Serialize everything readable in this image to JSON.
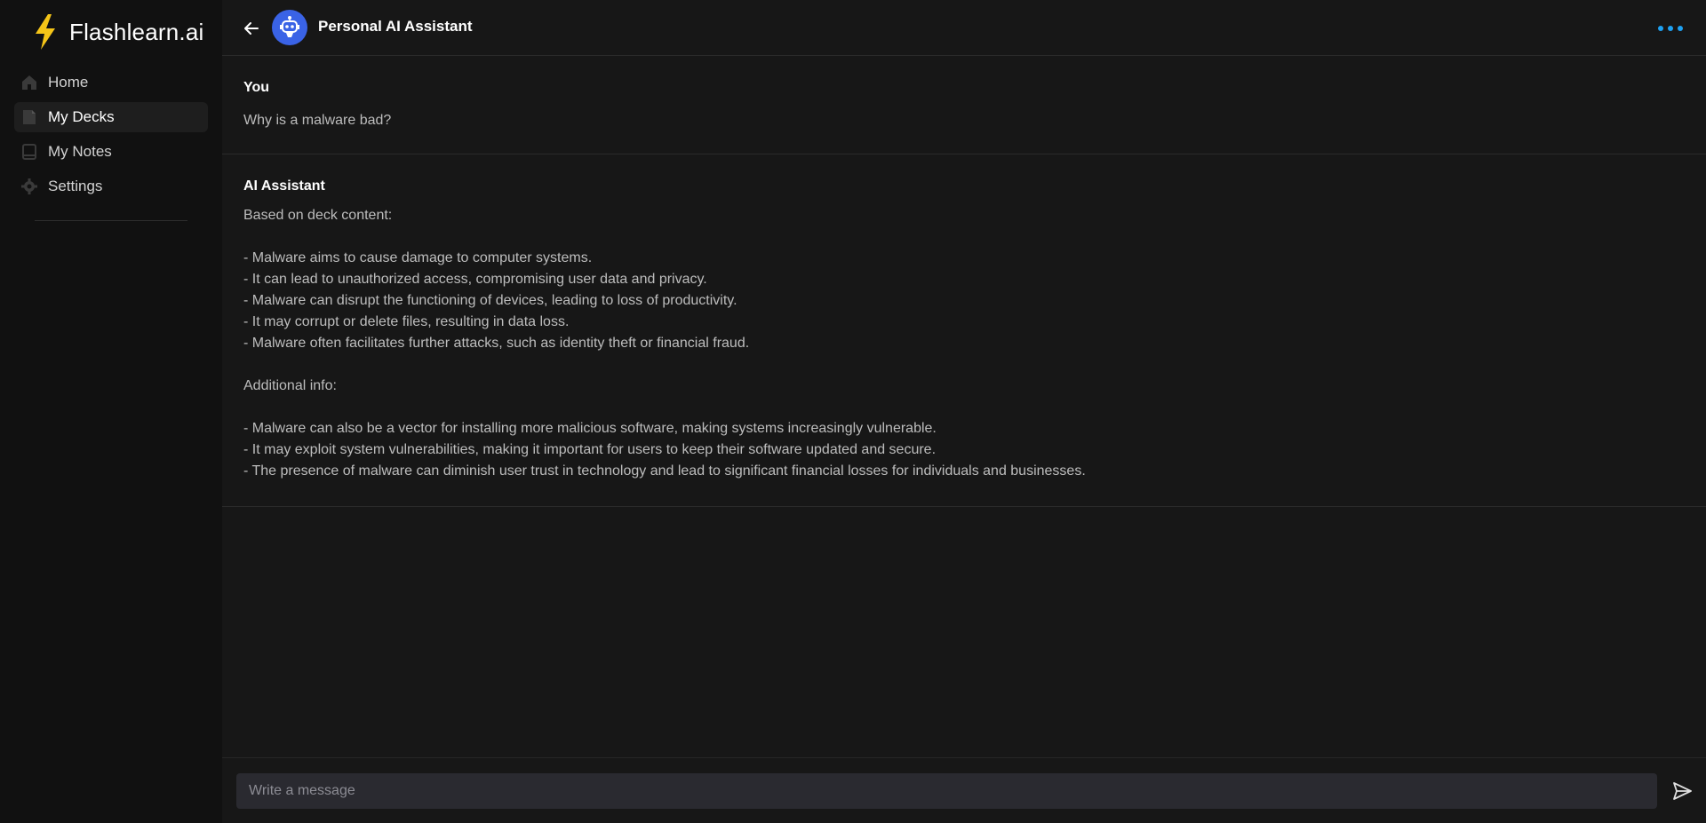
{
  "app": {
    "brand_name": "Flashlearn.ai",
    "brand_color": "#f5c518",
    "accent_color": "#1ea1f2",
    "avatar_color": "#3a63e6"
  },
  "sidebar": {
    "items": [
      {
        "label": "Home",
        "icon": "home-icon",
        "active": false
      },
      {
        "label": "My Decks",
        "icon": "deck-icon",
        "active": true
      },
      {
        "label": "My Notes",
        "icon": "notebook-icon",
        "active": false
      },
      {
        "label": "Settings",
        "icon": "gear-icon",
        "active": false
      }
    ]
  },
  "header": {
    "title": "Personal AI Assistant",
    "back_icon": "arrow-left-icon",
    "avatar_icon": "robot-icon",
    "menu_icon": "more-dots-icon"
  },
  "messages": [
    {
      "author": "You",
      "text": "Why is a malware bad?"
    },
    {
      "author": "AI Assistant",
      "lines": [
        "Based on deck content:",
        "",
        "- Malware aims to cause damage to computer systems.",
        "- It can lead to unauthorized access, compromising user data and privacy.",
        "- Malware can disrupt the functioning of devices, leading to loss of productivity.",
        "- It may corrupt or delete files, resulting in data loss.",
        "- Malware often facilitates further attacks, such as identity theft or financial fraud.",
        "",
        "Additional info:",
        "",
        "- Malware can also be a vector for installing more malicious software, making systems increasingly vulnerable.",
        "- It may exploit system vulnerabilities, making it important for users to keep their software updated and secure.",
        "- The presence of malware can diminish user trust in technology and lead to significant financial losses for individuals and businesses."
      ]
    }
  ],
  "composer": {
    "placeholder": "Write a message",
    "value": "",
    "send_icon": "send-icon"
  }
}
